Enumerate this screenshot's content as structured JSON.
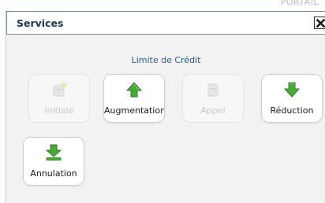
{
  "top_strip": {
    "text": "PORTAIL"
  },
  "dialog": {
    "title": "Services",
    "close_label": "×"
  },
  "section": {
    "title": "Limite de Crédit"
  },
  "tiles": [
    {
      "label": "Initiale",
      "icon": "document-star-icon",
      "enabled": false
    },
    {
      "label": "Augmentation",
      "icon": "arrow-up-icon",
      "enabled": true
    },
    {
      "label": "Appel",
      "icon": "document-icon",
      "enabled": false
    },
    {
      "label": "Réduction",
      "icon": "arrow-down-icon",
      "enabled": true
    },
    {
      "label": "Annulation",
      "icon": "arrow-down-bar-icon",
      "enabled": true
    }
  ],
  "colors": {
    "title_border": "#7a8ea8",
    "title_text": "#1f3552",
    "section_text": "#2b5a8a",
    "icon_green": "#4aa839"
  }
}
